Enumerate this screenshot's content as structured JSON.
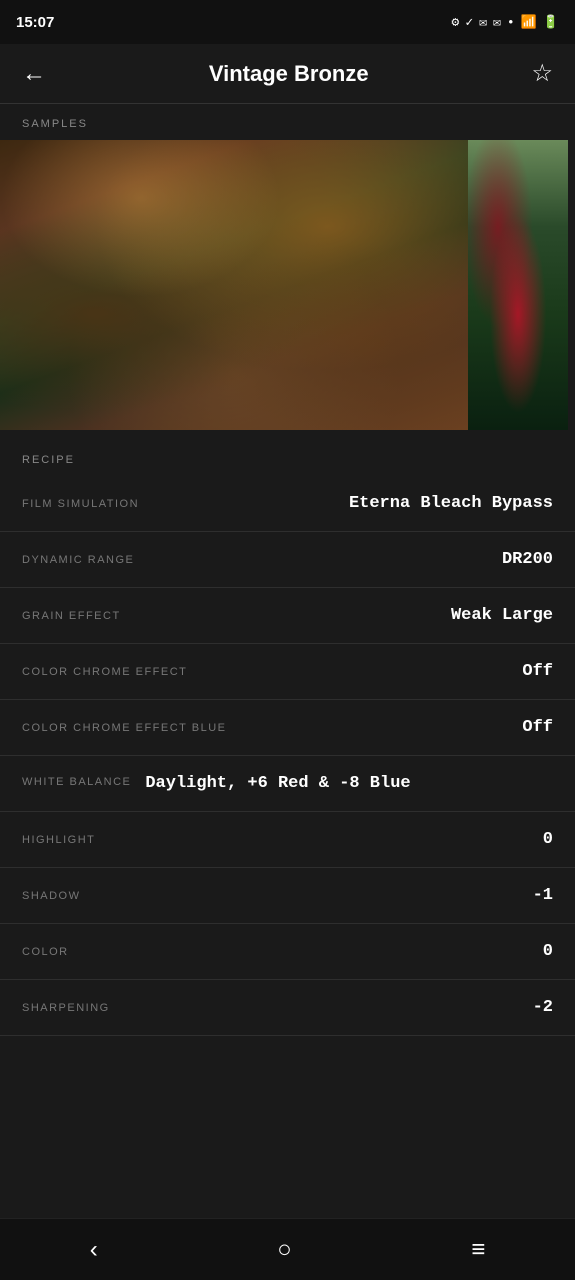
{
  "statusBar": {
    "time": "15:07",
    "icons": "⚙ ✓ ✉ ✉ •"
  },
  "topNav": {
    "title": "Vintage Bronze",
    "backLabel": "‹",
    "starLabel": "☆"
  },
  "samples": {
    "sectionLabel": "SAMPLES"
  },
  "recipe": {
    "sectionLabel": "RECIPE",
    "rows": [
      {
        "label": "FILM SIMULATION",
        "value": "Eterna Bleach Bypass"
      },
      {
        "label": "DYNAMIC RANGE",
        "value": "DR200"
      },
      {
        "label": "GRAIN EFFECT",
        "value": "Weak Large"
      },
      {
        "label": "COLOR CHROME EFFECT",
        "value": "Off"
      },
      {
        "label": "COLOR CHROME EFFECT BLUE",
        "value": "Off"
      },
      {
        "label": "HIGHLIGHT",
        "value": "0"
      },
      {
        "label": "SHADOW",
        "value": "-1"
      },
      {
        "label": "COLOR",
        "value": "0"
      },
      {
        "label": "SHARPENING",
        "value": "-2"
      }
    ],
    "whiteBalance": {
      "label": "WHITE BALANCE",
      "value": "Daylight, +6 Red & -8 Blue"
    }
  },
  "bottomNav": {
    "backLabel": "‹",
    "homeLabel": "○",
    "menuLabel": "≡"
  }
}
